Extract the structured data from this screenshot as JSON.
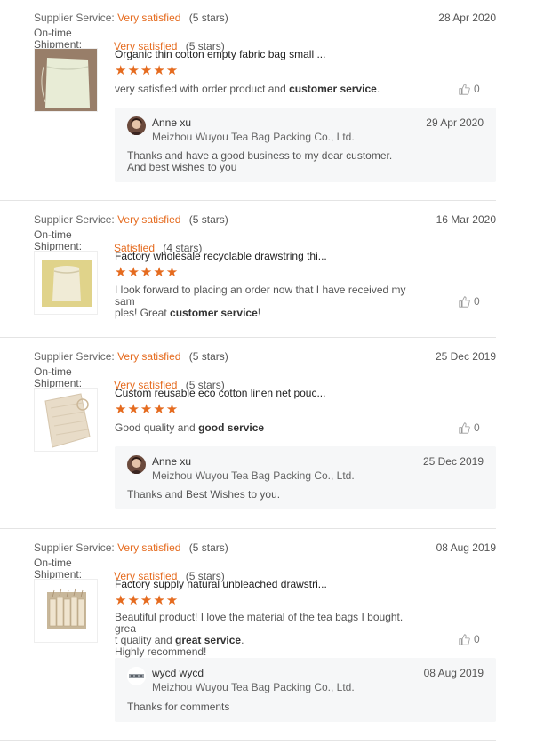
{
  "labels": {
    "supplier_service": "Supplier Service:",
    "on_time_shipment": "On-time Shipment:"
  },
  "colors": {
    "accent": "#e56b1f"
  },
  "reviews": [
    {
      "supplier_rating": "Very satisfied",
      "supplier_stars": "(5 stars)",
      "date": "28 Apr 2020",
      "shipment_rating": "Very satisfied",
      "shipment_stars": "(5 stars)",
      "product": "Organic thin cotton empty fabric bag small ...",
      "product_stars": 5,
      "comment_pre": "very satisfied with order product and ",
      "comment_bold": "customer service",
      "comment_post": ".",
      "likes": "0",
      "reply": {
        "name": "Anne xu",
        "company": "Meizhou Wuyou Tea Bag Packing Co., Ltd.",
        "date": "29 Apr 2020",
        "text_line1": "Thanks and have a good business to my dear customer.",
        "text_line2": "And best wishes to you"
      }
    },
    {
      "supplier_rating": "Very satisfied",
      "supplier_stars": "(5 stars)",
      "date": "16 Mar 2020",
      "shipment_rating": "Satisfied",
      "shipment_stars": "(4 stars)",
      "product": "Factory wholesale recyclable drawstring thi...",
      "product_stars": 5,
      "comment_line1": "I look forward to placing an order now that I have received my sam",
      "comment_pre": "ples! Great ",
      "comment_bold": "customer service",
      "comment_post": "!",
      "likes": "0"
    },
    {
      "supplier_rating": "Very satisfied",
      "supplier_stars": "(5 stars)",
      "date": "25 Dec 2019",
      "shipment_rating": "Very satisfied",
      "shipment_stars": "(5 stars)",
      "product": "Custom reusable eco cotton linen net pouc...",
      "product_stars": 5,
      "comment_pre": "Good quality and ",
      "comment_bold": "good service",
      "comment_post": "",
      "likes": "0",
      "reply": {
        "name": "Anne xu",
        "company": "Meizhou Wuyou Tea Bag Packing Co., Ltd.",
        "date": "25 Dec 2019",
        "text_line1": "Thanks and Best Wishes to you."
      }
    },
    {
      "supplier_rating": "Very satisfied",
      "supplier_stars": "(5 stars)",
      "date": "08 Aug 2019",
      "shipment_rating": "Very satisfied",
      "shipment_stars": "(5 stars)",
      "product": "Factory supply natural unbleached drawstri...",
      "product_stars": 5,
      "comment_line1": "Beautiful product! I love the material of the tea bags I bought. grea",
      "comment_pre": "t quality and ",
      "comment_bold": "great service",
      "comment_post": ".",
      "comment_line3": "Highly recommend!",
      "likes": "0",
      "reply": {
        "name": "wycd wycd",
        "company": "Meizhou Wuyou Tea Bag Packing Co., Ltd.",
        "date": "08 Aug 2019",
        "text_line1": "Thanks for comments"
      }
    }
  ]
}
